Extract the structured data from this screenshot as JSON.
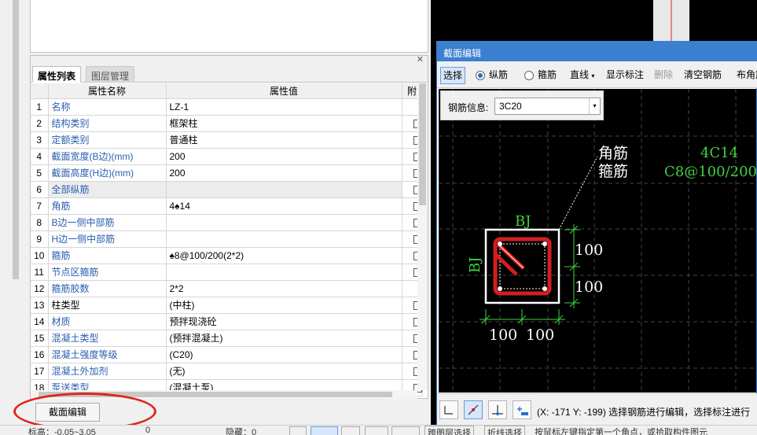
{
  "properties_panel": {
    "tabs": [
      "属性列表",
      "图层管理"
    ],
    "columns": [
      "属性名称",
      "属性值",
      "附"
    ],
    "rows": [
      {
        "num": "1",
        "name": "名称",
        "value": "LZ-1",
        "blue": true,
        "checkbox": false,
        "gray": false
      },
      {
        "num": "2",
        "name": "结构类别",
        "value": "框架柱",
        "blue": true,
        "checkbox": true,
        "gray": false
      },
      {
        "num": "3",
        "name": "定额类别",
        "value": "普通柱",
        "blue": true,
        "checkbox": true,
        "gray": false
      },
      {
        "num": "4",
        "name": "截面宽度(B边)(mm)",
        "value": "200",
        "blue": true,
        "checkbox": true,
        "gray": false
      },
      {
        "num": "5",
        "name": "截面高度(H边)(mm)",
        "value": "200",
        "blue": true,
        "checkbox": true,
        "gray": false
      },
      {
        "num": "6",
        "name": "全部纵筋",
        "value": "",
        "blue": true,
        "checkbox": true,
        "gray": true
      },
      {
        "num": "7",
        "name": "角筋",
        "value": "4♠︎14",
        "blue": true,
        "checkbox": true,
        "gray": false
      },
      {
        "num": "8",
        "name": "B边一侧中部筋",
        "value": "",
        "blue": true,
        "checkbox": true,
        "gray": false
      },
      {
        "num": "9",
        "name": "H边一侧中部筋",
        "value": "",
        "blue": true,
        "checkbox": true,
        "gray": false
      },
      {
        "num": "10",
        "name": "箍筋",
        "value": "♠︎8@100/200(2*2)",
        "blue": true,
        "checkbox": true,
        "gray": false
      },
      {
        "num": "11",
        "name": "节点区箍筋",
        "value": "",
        "blue": true,
        "checkbox": true,
        "gray": false
      },
      {
        "num": "12",
        "name": "箍筋胶数",
        "value": "2*2",
        "blue": true,
        "checkbox": false,
        "gray": false
      },
      {
        "num": "13",
        "name": "柱类型",
        "value": "(中柱)",
        "blue": false,
        "checkbox": true,
        "gray": false
      },
      {
        "num": "14",
        "name": "材质",
        "value": "预拌现浇砼",
        "blue": true,
        "checkbox": true,
        "gray": false
      },
      {
        "num": "15",
        "name": "混凝土类型",
        "value": "(预拌混凝土)",
        "blue": true,
        "checkbox": true,
        "gray": false
      },
      {
        "num": "16",
        "name": "混凝土强度等级",
        "value": "(C20)",
        "blue": true,
        "checkbox": true,
        "gray": false
      },
      {
        "num": "17",
        "name": "混凝土外加剂",
        "value": "(无)",
        "blue": true,
        "checkbox": true,
        "gray": false
      },
      {
        "num": "18",
        "name": "泵送类型",
        "value": "(混凝土泵)",
        "blue": true,
        "checkbox": true,
        "gray": false
      }
    ],
    "edit_button": "截面编辑"
  },
  "section_dialog": {
    "title": "截面编辑",
    "toolbar": {
      "select": "选择",
      "longitudinal": "纵筋",
      "stirrup": "箍筋",
      "line": "直线",
      "show_label": "显示标注",
      "delete": "删除",
      "clear": "清空钢筋",
      "layout_corner": "布角筋"
    },
    "rebar_info_label": "钢筋信息:",
    "rebar_info_value": "3C20",
    "canvas": {
      "label_corner": "角筋",
      "label_stirrup": "箍筋",
      "label_4c14": "4C14",
      "label_c8": "C8@100/200",
      "label_bj_top": "BJ",
      "label_bj_left": "BJ",
      "dim_right_top": "100",
      "dim_right_bottom": "100",
      "dim_bottom_left": "100",
      "dim_bottom_right": "100"
    },
    "status": "(X: -171 Y: -199)  选择钢筋进行编辑，选择标注进行"
  },
  "statusbar": {
    "left": "标高：-0.05~3.05",
    "zero": "0",
    "hide": "隐藏：0",
    "buttons": [
      "跨图层选择",
      "折线选择"
    ],
    "hint": "按鼠标左键指定第一个角点，或拾取构件图元"
  },
  "colors": {
    "accent": "#3b7fd1",
    "red_mark": "#e0241a",
    "cad_green": "#3fd13f",
    "rebar_red": "#d31e1e"
  }
}
